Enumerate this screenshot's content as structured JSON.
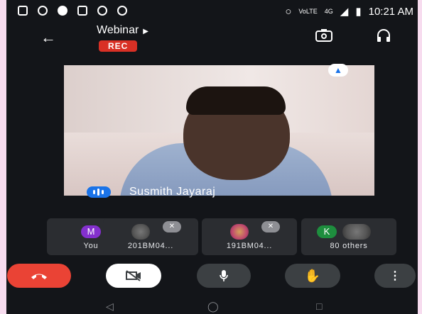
{
  "status_bar": {
    "time": "10:21 AM",
    "network": "4G",
    "volte": "VoLTE"
  },
  "meeting": {
    "title": "Webinar",
    "recording_badge": "REC"
  },
  "main_video": {
    "participant_name": "Susmith Jayaraj"
  },
  "participants": [
    {
      "avatar_letter": "M",
      "label": "You",
      "avatar_color": "#8430ce"
    },
    {
      "label": "201BM04..."
    },
    {
      "label": "191BM04..."
    },
    {
      "avatar_letter": "K",
      "label": "80 others",
      "avatar_color": "#1e8e3e"
    }
  ],
  "colors": {
    "end_call": "#ea4335",
    "rec": "#d93025",
    "accent": "#1a73e8",
    "control_bg": "#3c4043"
  },
  "icons": {
    "back": "arrow-left-icon",
    "switch_camera": "switch-camera-icon",
    "audio_output": "headphones-icon",
    "pin": "pin-icon",
    "end_call": "end-call-icon",
    "camera": "camera-off-icon",
    "mic": "mic-icon",
    "raise_hand": "raise-hand-icon",
    "more": "more-vert-icon"
  }
}
